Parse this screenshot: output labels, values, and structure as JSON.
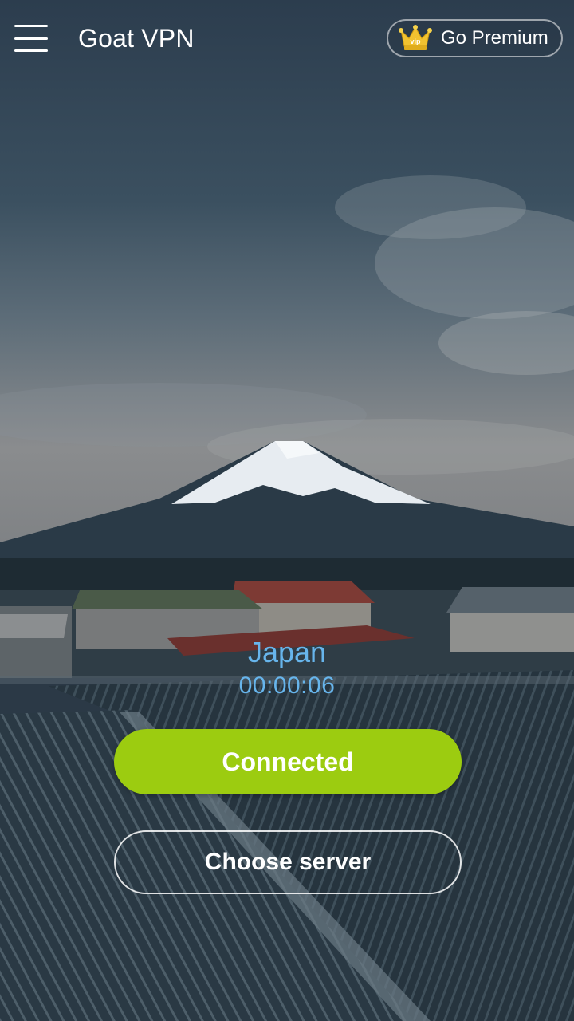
{
  "header": {
    "app_title": "Goat VPN",
    "menu_icon": "hamburger-menu-icon",
    "premium_label": "Go Premium",
    "premium_icon": "vip-crown-icon",
    "premium_badge_text": "vip"
  },
  "connection": {
    "location": "Japan",
    "duration": "00:00:06"
  },
  "actions": {
    "status_button_label": "Connected",
    "choose_server_label": "Choose server"
  },
  "colors": {
    "accent_green": "#9ccc10",
    "info_blue": "#67b5ec",
    "crown_gold": "#f2c230"
  }
}
